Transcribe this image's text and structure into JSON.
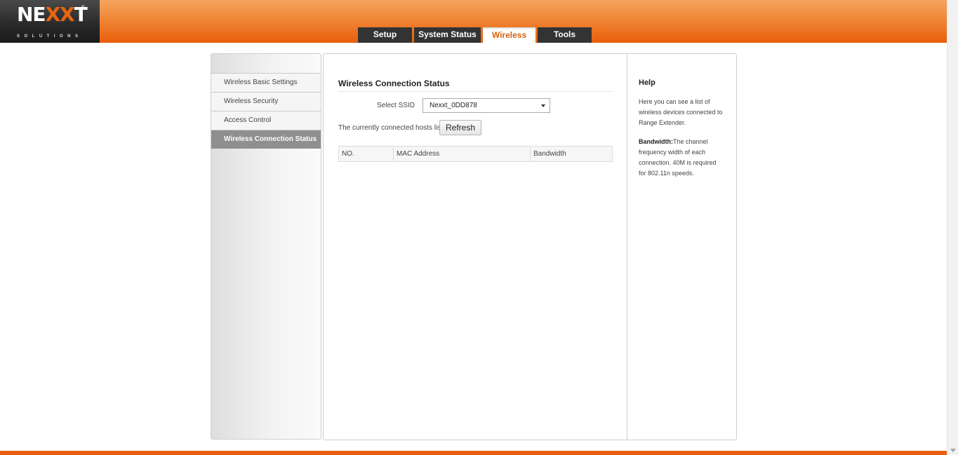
{
  "logo": {
    "brand_pre": "NE",
    "brand_x": "XX",
    "brand_post": "T",
    "subtitle": "SOLUTIONS"
  },
  "nav": {
    "tabs": [
      {
        "label": "Setup"
      },
      {
        "label": "System Status"
      },
      {
        "label": "Wireless",
        "active": true
      },
      {
        "label": "Tools"
      }
    ]
  },
  "sidebar": {
    "items": [
      {
        "label": "Wireless Basic Settings"
      },
      {
        "label": "Wireless Security"
      },
      {
        "label": "Access Control"
      },
      {
        "label": "Wireless Connection Status",
        "active": true
      }
    ]
  },
  "main": {
    "title": "Wireless Connection Status",
    "ssid_label": "Select SSID",
    "ssid_value": "Nexxt_0DD878",
    "hosts_label": "The currently connected hosts list:",
    "refresh_label": "Refresh",
    "table": {
      "columns": [
        "NO.",
        "MAC Address",
        "Bandwidth"
      ],
      "rows": []
    }
  },
  "help": {
    "title": "Help",
    "para1": "Here you can see a list of wireless devices connected to Range Extender.",
    "para2_bold": "Bandwidth:",
    "para2_text": "The channel frequency width of each connection. 40M is required for 802.11n speeds."
  },
  "colors": {
    "accent": "#e85e0c",
    "tab_bg": "#333333",
    "active_tab_text": "#d8600e"
  }
}
